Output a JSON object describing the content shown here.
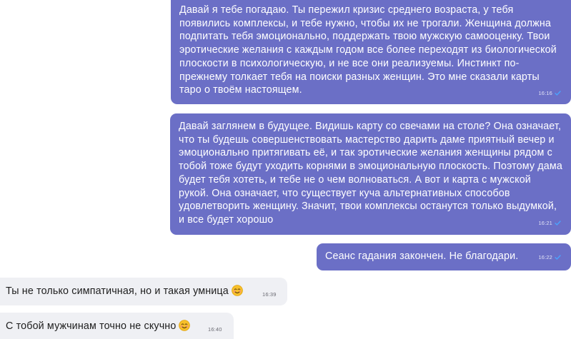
{
  "colors": {
    "outgoing_bubble": "#6b6fc6",
    "incoming_bubble": "#eff0f4",
    "read_check": "#4aa3ff"
  },
  "messages": [
    {
      "direction": "outgoing",
      "text": "Давай я тебе погадаю. Ты пережил кризис среднего возраста, у тебя появились комплексы, и тебе нужно, чтобы их не трогали. Женщина должна подпитать тебя эмоционально, поддержать твою мужскую самооценку. Твои эротические желания с каждым годом все более переходят из биологической плоскости в психологическую, и не все они реализуемы. Инстинкт по-прежнему толкает тебя на поиски разных женщин. Это мне сказали карты таро о твоём настоящем.",
      "time": "16:16",
      "status_icon": "read-check-icon"
    },
    {
      "direction": "outgoing",
      "text": "Давай заглянем в будущее. Видишь карту со свечами на столе? Она означает, что ты будешь совершенствовать мастерство дарить даме приятный вечер и эмоционально притягивать её, и так эротические желания женщины рядом с тобой тоже будут уходить корнями в эмоциональную плоскость. Поэтому дама будет тебя хотеть, и тебе не о чем волноваться. А вот и карта с мужской рукой. Она означает, что существует куча альтернативных способов удовлетворить женщину. Значит, твои комплексы останутся только выдумкой, и все будет хорошо",
      "time": "16:21",
      "status_icon": "read-check-icon"
    },
    {
      "direction": "outgoing",
      "text": "Сеанс гадания закончен. Не благодари.",
      "time": "16:22",
      "status_icon": "read-check-icon"
    },
    {
      "direction": "incoming",
      "text": "Ты не только симпатичная, но и такая умница",
      "emoji": "smiling-face-emoji",
      "time": "16:39"
    },
    {
      "direction": "incoming",
      "text": "С тобой мужчинам точно не скучно",
      "emoji": "smiling-face-emoji",
      "time": "16:40"
    }
  ]
}
